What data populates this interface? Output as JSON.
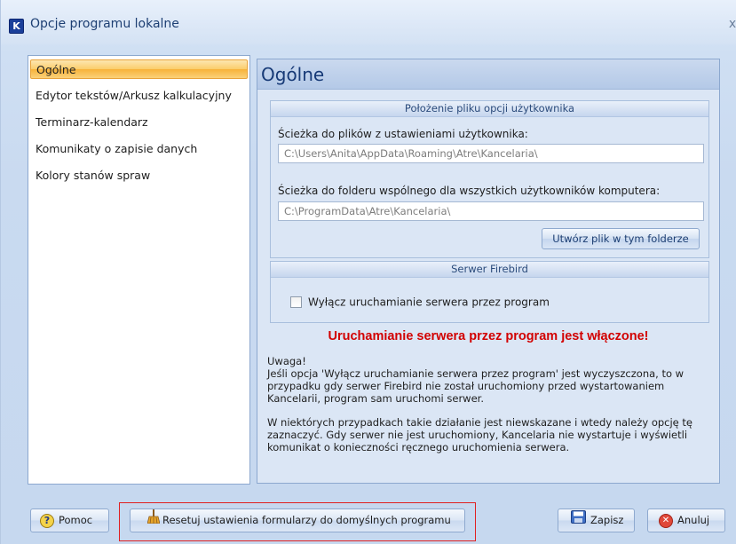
{
  "window": {
    "title": "Opcje programu lokalne",
    "close_glyph": "x"
  },
  "nav": {
    "items": [
      {
        "label": "Ogólne",
        "selected": true
      },
      {
        "label": "Edytor tekstów/Arkusz kalkulacyjny",
        "selected": false
      },
      {
        "label": "Terminarz-kalendarz",
        "selected": false
      },
      {
        "label": "Komunikaty o zapisie danych",
        "selected": false
      },
      {
        "label": "Kolory stanów spraw",
        "selected": false
      }
    ]
  },
  "content": {
    "title": "Ogólne",
    "user_file_group": {
      "header": "Położenie pliku opcji  użytkownika",
      "user_path_label": "Ścieżka do plików z ustawieniami użytkownika:",
      "user_path_value": "C:\\Users\\Anita\\AppData\\Roaming\\Atre\\Kancelaria\\",
      "shared_path_label": "Ścieżka do folderu wspólnego dla wszystkich użytkowników komputera:",
      "shared_path_value": "C:\\ProgramData\\Atre\\Kancelaria\\",
      "create_button": "Utwórz plik w tym folderze"
    },
    "firebird_group": {
      "header": "Serwer Firebird",
      "checkbox_label": "Wyłącz uruchamianie serwera przez program",
      "checked": false
    },
    "warning": "Uruchamianie serwera przez program jest włączone!",
    "note_lines_1": [
      "Uwaga!",
      "Jeśli opcja 'Wyłącz uruchamianie serwera przez program' jest wyczyszczona, to w",
      "przypadku gdy serwer Firebird nie został uruchomiony przed wystartowaniem",
      "Kancelarii, program sam uruchomi serwer."
    ],
    "note_lines_2": [
      "W niektórych przypadkach takie działanie jest niewskazane i wtedy należy opcję tę",
      "zaznaczyć. Gdy serwer nie jest uruchomiony, Kancelaria nie wystartuje i wyświetli",
      "komunikat o konieczności ręcznego uruchomienia serwera."
    ]
  },
  "footer": {
    "help_label": "Pomoc",
    "help_glyph": "?",
    "reset_label": "Resetuj ustawienia formularzy do domyślnych programu",
    "save_label": "Zapisz",
    "cancel_label": "Anuluj",
    "cancel_glyph": "✕"
  },
  "icons": {
    "app": "app-logo-icon",
    "help": "help-icon",
    "reset": "broom-icon",
    "save": "floppy-disk-icon",
    "cancel": "cancel-icon"
  },
  "colors": {
    "selection": "#fbcd6a",
    "warning": "#d20000",
    "panel_border": "#8ca8cf",
    "highlight_box": "#e02020"
  }
}
